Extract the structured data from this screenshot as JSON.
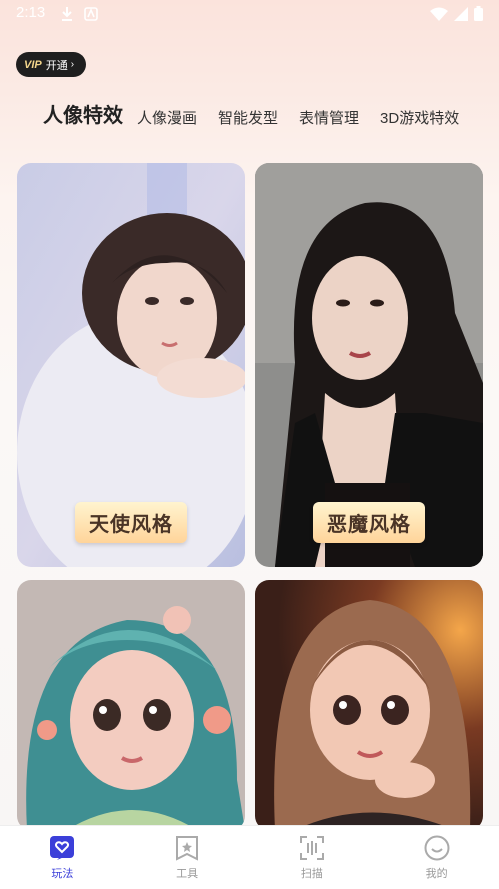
{
  "status_bar": {
    "time": "2:13",
    "icons_left": [
      "download-icon",
      "app-notification-icon"
    ],
    "icons_right": [
      "wifi-icon",
      "signal-icon",
      "battery-icon"
    ]
  },
  "vip": {
    "badge": "VIP",
    "label": "开通",
    "chevron": "›"
  },
  "tabs": [
    {
      "label": "人像特效",
      "active": true
    },
    {
      "label": "人像漫画",
      "active": false
    },
    {
      "label": "智能发型",
      "active": false
    },
    {
      "label": "表情管理",
      "active": false
    },
    {
      "label": "3D游戏特效",
      "active": false
    }
  ],
  "cards": [
    {
      "label": "天使风格",
      "image": "angel-style-portrait"
    },
    {
      "label": "恶魔风格",
      "image": "devil-style-portrait"
    },
    {
      "label": "",
      "image": "3d-cartoon-girl-teal-hair"
    },
    {
      "label": "",
      "image": "3d-cartoon-girl-brown-hair"
    }
  ],
  "bottom_nav": [
    {
      "label": "玩法",
      "icon": "heart-chat-icon",
      "active": true
    },
    {
      "label": "工具",
      "icon": "bookmark-star-icon",
      "active": false
    },
    {
      "label": "扫描",
      "icon": "scan-icon",
      "active": false
    },
    {
      "label": "我的",
      "icon": "smiley-icon",
      "active": false
    }
  ],
  "colors": {
    "accent": "#3b3fd9",
    "label_bg": "#ffd49a",
    "vip_gold": "#f3d58b"
  }
}
